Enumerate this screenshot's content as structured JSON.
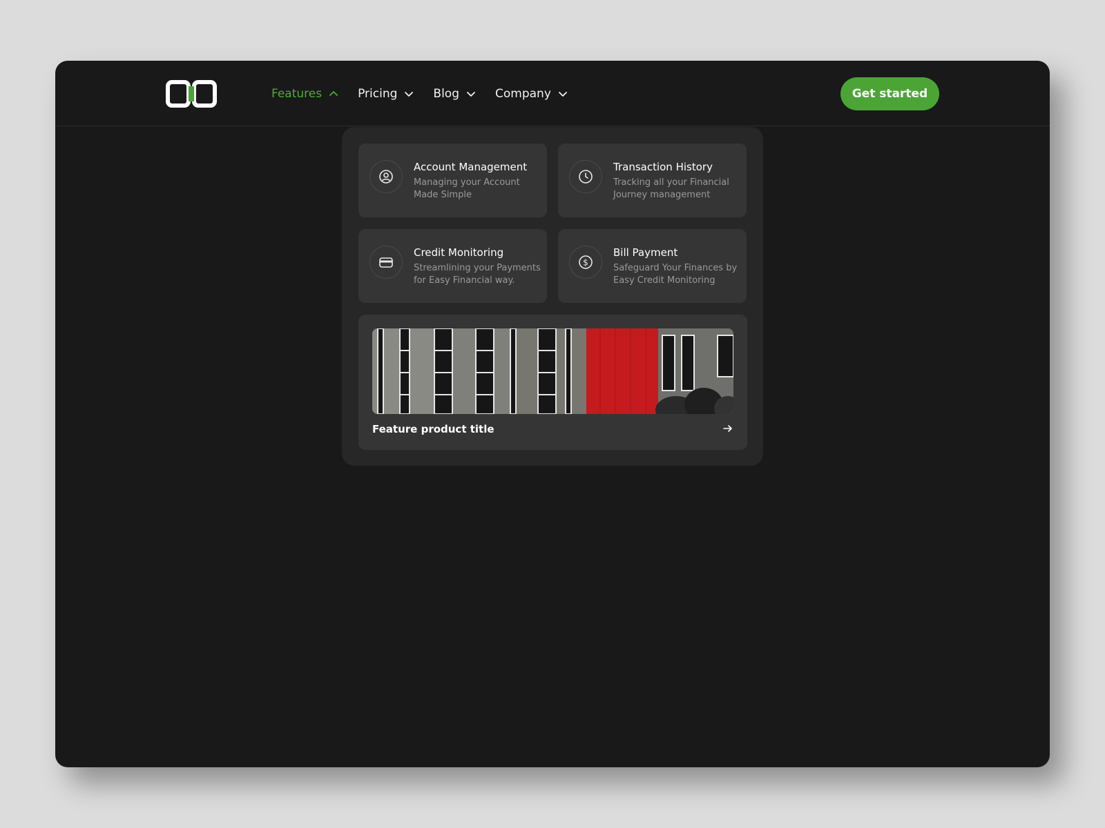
{
  "nav": {
    "items": [
      {
        "label": "Features",
        "active": true,
        "icon": "chevron-up-icon"
      },
      {
        "label": "Pricing",
        "active": false,
        "icon": "chevron-down-icon"
      },
      {
        "label": "Blog",
        "active": false,
        "icon": "chevron-down-icon"
      },
      {
        "label": "Company",
        "active": false,
        "icon": "chevron-down-icon"
      }
    ],
    "cta_label": "Get started"
  },
  "menu": {
    "cards": [
      {
        "title": "Account Management",
        "desc": "Managing your Account Made Simple",
        "icon": "user-circle-icon"
      },
      {
        "title": "Transaction History",
        "desc": "Tracking all your Financial Journey management",
        "icon": "clock-icon"
      },
      {
        "title": "Credit Monitoring",
        "desc": "Streamlining your Payments for Easy Financial way.",
        "icon": "credit-card-icon"
      },
      {
        "title": "Bill Payment",
        "desc": "Safeguard Your Finances by Easy Credit Monitoring",
        "icon": "dollar-circle-icon"
      }
    ],
    "feature": {
      "title": "Feature product title",
      "icon": "arrow-right-icon"
    }
  },
  "colors": {
    "accent": "#4aa535",
    "background": "#191919",
    "panel": "#272727",
    "card": "#353535"
  }
}
